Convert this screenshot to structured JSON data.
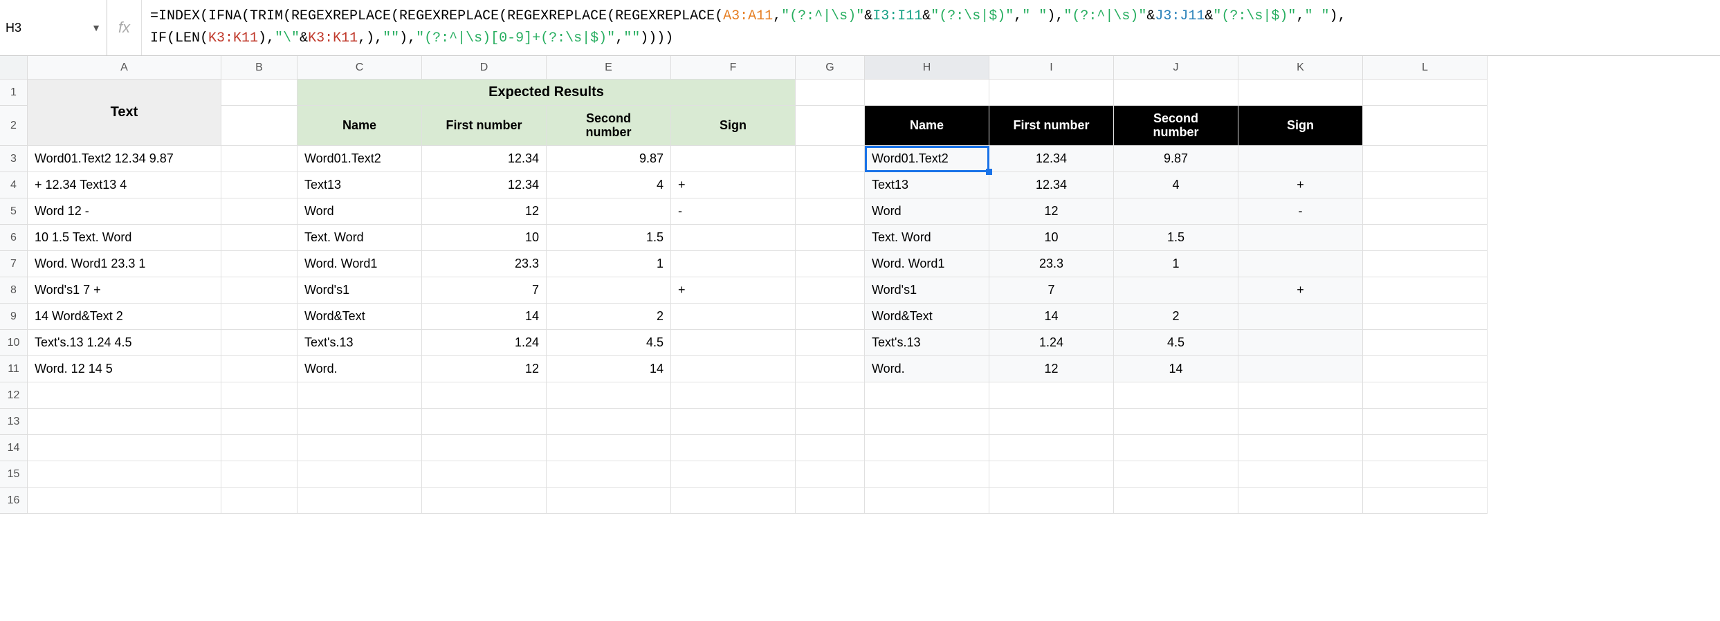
{
  "cellRef": "H3",
  "formula": {
    "line1_parts": [
      {
        "cls": "tok-black",
        "t": "=INDEX(IFNA(TRIM(REGEXREPLACE(REGEXREPLACE(REGEXREPLACE(REGEXREPLACE("
      },
      {
        "cls": "tok-orange",
        "t": "A3:A11"
      },
      {
        "cls": "tok-black",
        "t": ","
      },
      {
        "cls": "tok-green",
        "t": "\"(?:^|\\s)\""
      },
      {
        "cls": "tok-black",
        "t": "&"
      },
      {
        "cls": "tok-teal",
        "t": "I3:I11"
      },
      {
        "cls": "tok-black",
        "t": "&"
      },
      {
        "cls": "tok-green",
        "t": "\"(?:\\s|$)\""
      },
      {
        "cls": "tok-black",
        "t": ","
      },
      {
        "cls": "tok-green",
        "t": "\" \""
      },
      {
        "cls": "tok-black",
        "t": "),"
      },
      {
        "cls": "tok-green",
        "t": "\"(?:^|\\s)\""
      },
      {
        "cls": "tok-black",
        "t": "&"
      },
      {
        "cls": "tok-blue",
        "t": "J3:J11"
      },
      {
        "cls": "tok-black",
        "t": "&"
      },
      {
        "cls": "tok-green",
        "t": "\"(?:\\s|$)\""
      },
      {
        "cls": "tok-black",
        "t": ","
      },
      {
        "cls": "tok-green",
        "t": "\" \""
      },
      {
        "cls": "tok-black",
        "t": "),"
      }
    ],
    "line2_parts": [
      {
        "cls": "tok-black",
        "t": "IF(LEN("
      },
      {
        "cls": "tok-red",
        "t": "K3:K11"
      },
      {
        "cls": "tok-black",
        "t": "),"
      },
      {
        "cls": "tok-green",
        "t": "\"\\\""
      },
      {
        "cls": "tok-black",
        "t": "&"
      },
      {
        "cls": "tok-red",
        "t": "K3:K11"
      },
      {
        "cls": "tok-black",
        "t": ",),"
      },
      {
        "cls": "tok-green",
        "t": "\"\""
      },
      {
        "cls": "tok-black",
        "t": "),"
      },
      {
        "cls": "tok-green",
        "t": "\"(?:^|\\s)[0-9]+(?:\\s|$)\""
      },
      {
        "cls": "tok-black",
        "t": ","
      },
      {
        "cls": "tok-green",
        "t": "\"\""
      },
      {
        "cls": "tok-black",
        "t": "))))"
      }
    ]
  },
  "columns": [
    "A",
    "B",
    "C",
    "D",
    "E",
    "F",
    "G",
    "H",
    "I",
    "J",
    "K",
    "L"
  ],
  "headers": {
    "text": "Text",
    "expected": "Expected Results",
    "name": "Name",
    "first": "First number",
    "second1": "Second",
    "second2": "number",
    "sign": "Sign"
  },
  "rows": [
    {
      "n": 3,
      "text": "Word01.Text2 12.34 9.87",
      "ename": "Word01.Text2",
      "efirst": "12.34",
      "esecond": "9.87",
      "esign": "",
      "rname": "Word01.Text2",
      "rfirst": "12.34",
      "rsecond": "9.87",
      "rsign": ""
    },
    {
      "n": 4,
      "text": "+ 12.34 Text13 4",
      "ename": "Text13",
      "efirst": "12.34",
      "esecond": "4",
      "esign": "+",
      "rname": "Text13",
      "rfirst": "12.34",
      "rsecond": "4",
      "rsign": "+"
    },
    {
      "n": 5,
      "text": "Word 12 -",
      "ename": "Word",
      "efirst": "12",
      "esecond": "",
      "esign": "-",
      "rname": "Word",
      "rfirst": "12",
      "rsecond": "",
      "rsign": "-"
    },
    {
      "n": 6,
      "text": "10 1.5 Text. Word",
      "ename": "Text. Word",
      "efirst": "10",
      "esecond": "1.5",
      "esign": "",
      "rname": "Text. Word",
      "rfirst": "10",
      "rsecond": "1.5",
      "rsign": ""
    },
    {
      "n": 7,
      "text": "Word. Word1 23.3 1",
      "ename": "Word. Word1",
      "efirst": "23.3",
      "esecond": "1",
      "esign": "",
      "rname": "Word. Word1",
      "rfirst": "23.3",
      "rsecond": "1",
      "rsign": ""
    },
    {
      "n": 8,
      "text": "Word's1 7 +",
      "ename": "Word's1",
      "efirst": "7",
      "esecond": "",
      "esign": "+",
      "rname": "Word's1",
      "rfirst": "7",
      "rsecond": "",
      "rsign": "+"
    },
    {
      "n": 9,
      "text": "14 Word&Text 2",
      "ename": "Word&Text",
      "efirst": "14",
      "esecond": "2",
      "esign": "",
      "rname": "Word&Text",
      "rfirst": "14",
      "rsecond": "2",
      "rsign": ""
    },
    {
      "n": 10,
      "text": "Text's.13 1.24 4.5",
      "ename": "Text's.13",
      "efirst": "1.24",
      "esecond": "4.5",
      "esign": "",
      "rname": "Text's.13",
      "rfirst": "1.24",
      "rsecond": "4.5",
      "rsign": ""
    },
    {
      "n": 11,
      "text": "Word. 12 14 5",
      "ename": "Word.",
      "efirst": "12",
      "esecond": "14",
      "esign": "",
      "rname": "Word.",
      "rfirst": "12",
      "rsecond": "14",
      "rsign": ""
    }
  ],
  "emptyRows": [
    12,
    13,
    14,
    15,
    16
  ]
}
